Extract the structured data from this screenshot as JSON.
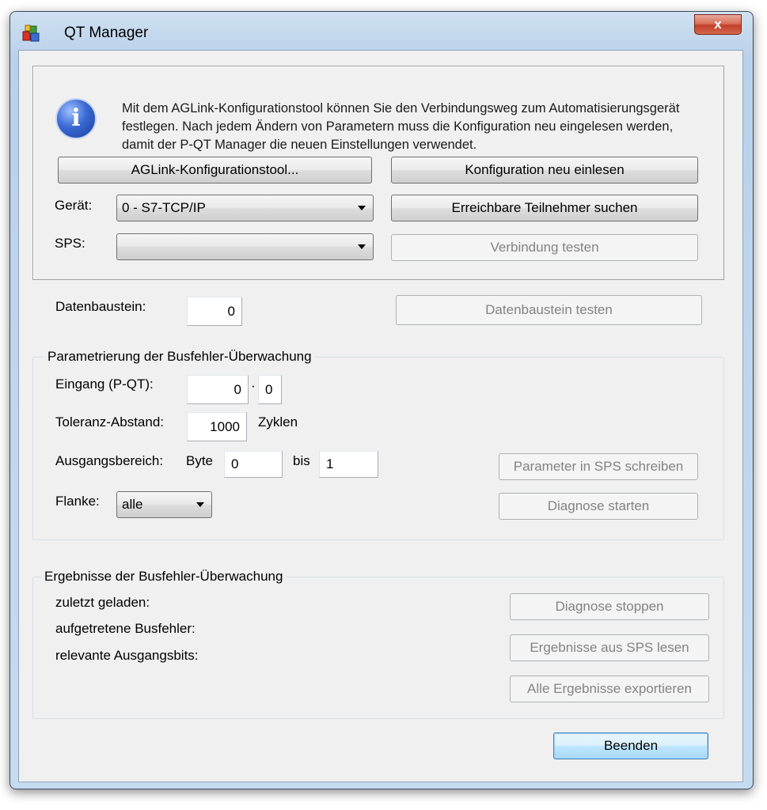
{
  "window": {
    "title": "QT Manager",
    "close_label": "x"
  },
  "info": {
    "icon_letter": "i",
    "line1": "Mit dem AGLink-Konfigurationstool können Sie den Verbindungsweg zum Automatisierungsgerät",
    "line2": "festlegen. Nach jedem Ändern von Parametern muss die Konfiguration neu eingelesen werden,",
    "line3": "damit der P-QT Manager die neuen Einstellungen verwendet."
  },
  "buttons": {
    "aglink_tool": "AGLink-Konfigurationstool...",
    "reload_config": "Konfiguration neu einlesen",
    "search_participants": "Erreichbare Teilnehmer suchen",
    "test_connection": "Verbindung testen",
    "test_datablock": "Datenbaustein testen",
    "write_params": "Parameter in SPS schreiben",
    "start_diagnosis": "Diagnose starten",
    "stop_diagnosis": "Diagnose stoppen",
    "read_results": "Ergebnisse aus SPS lesen",
    "export_results": "Alle Ergebnisse exportieren",
    "quit": "Beenden"
  },
  "connection": {
    "device_label": "Gerät:",
    "device_value": "0 - S7-TCP/IP",
    "plc_label": "SPS:",
    "plc_value": ""
  },
  "datablock": {
    "label": "Datenbaustein:",
    "value": "0"
  },
  "monitoring": {
    "title": "Parametrierung der Busfehler-Überwachung",
    "input_label": "Eingang (P-QT):",
    "input_byte": "0",
    "dot": "·",
    "input_bit": "0",
    "tolerance_label": "Toleranz-Abstand:",
    "tolerance_value": "1000",
    "tolerance_unit": "Zyklen",
    "output_label": "Ausgangsbereich:",
    "byte_label": "Byte",
    "output_from": "0",
    "to_label": "bis",
    "output_to": "1",
    "edge_label": "Flanke:",
    "edge_value": "alle"
  },
  "results": {
    "title": "Ergebnisse der Busfehler-Überwachung",
    "last_loaded": "zuletzt geladen:",
    "bus_errors": "aufgetretene Busfehler:",
    "relevant_bits": "relevante Ausgangsbits:"
  }
}
